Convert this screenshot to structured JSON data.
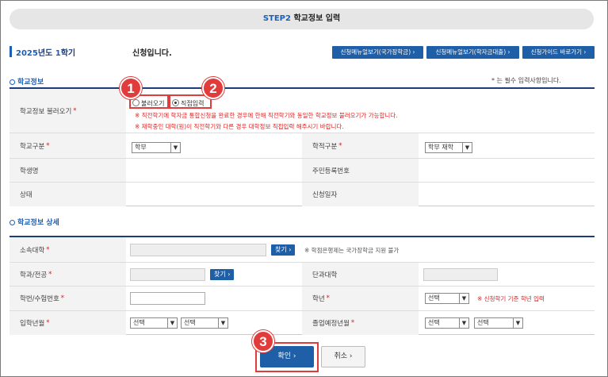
{
  "step": {
    "step_label": "STEP2",
    "title": "학교정보 입력"
  },
  "term": {
    "year": "2025",
    "year_suffix": "년도 ",
    "semester": "1",
    "semester_suffix": "학기",
    "apply_text": "신청입니다."
  },
  "nav_buttons": [
    {
      "label": "신청메뉴얼보기(국가장학금) ›"
    },
    {
      "label": "신청메뉴얼보기(학자금대출) ›"
    },
    {
      "label": "신청가이드 바로가기 ›"
    }
  ],
  "school_info": {
    "section_title": "학교정보",
    "required_note": "* 는 필수 입력사항입니다.",
    "load_label": "학교정보 불러오기",
    "radio_load": "불러오기",
    "radio_direct": "직접입력",
    "notice1": "※ 직전학기에 학자금 통합신청을 완료한 경우에 한해 직전학기와 동일한 학교정보 불러오기가 가능합니다.",
    "notice2": "※ 재학중인 대학(원)이 직전학기와 다른 경우 대학정보 직접입력 해주시기 바랍니다.",
    "school_type_label": "학교구분",
    "school_type_value": "학부",
    "enroll_label": "학적구분",
    "enroll_value": "학부 재학",
    "student_name_label": "학생명",
    "resident_label": "주민등록번호",
    "status_label": "상태",
    "apply_date_label": "신청일자"
  },
  "school_detail": {
    "section_title": "학교정보 상세",
    "university_label": "소속대학",
    "find_label": "찾기 ›",
    "university_note": "※ 학점은행제는 국가장학금 지원 불가",
    "major_label": "학과/전공",
    "college_label": "단과대학",
    "student_no_label": "학번/수험번호",
    "grade_label": "학년",
    "grade_value": "선택",
    "grade_note": "※ 신청학기 기준 학년 입력",
    "admission_label": "입학년월",
    "admission_year": "선택",
    "admission_month": "선택",
    "graduation_label": "졸업예정년월",
    "graduation_year": "선택",
    "graduation_month": "선택"
  },
  "required_mark": "*",
  "dropdown_arrow": "▼",
  "badges": [
    "1",
    "2",
    "3"
  ],
  "buttons": {
    "confirm": "확인 ›",
    "cancel": "취소 ›"
  },
  "colors": {
    "accent": "#1f5fa8",
    "annotation": "#e23b3b",
    "notice": "#d22222"
  }
}
